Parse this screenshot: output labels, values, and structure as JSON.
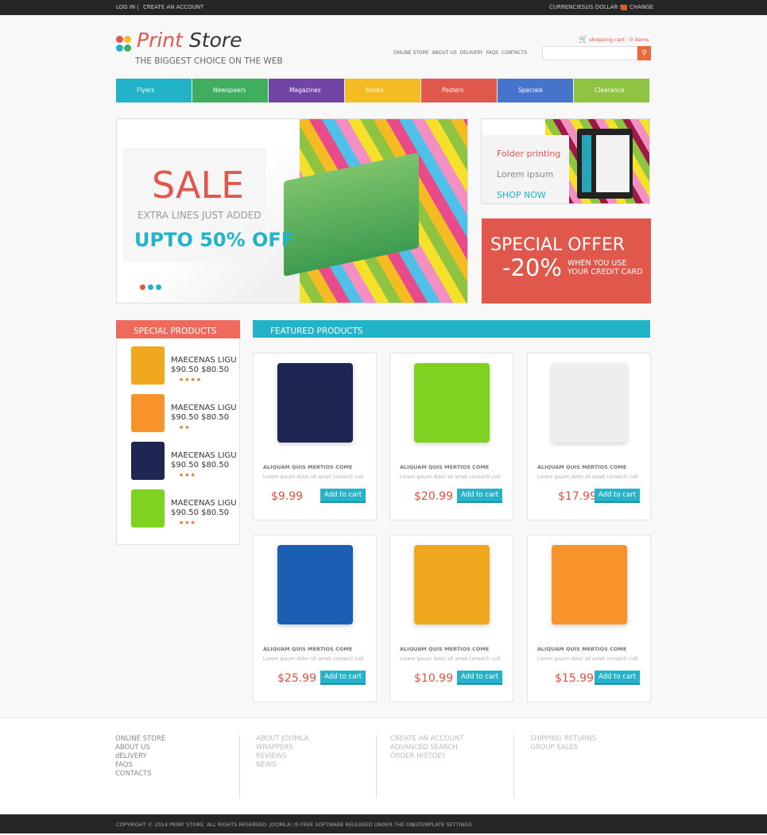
{
  "topbar": {
    "login": "LOG IN",
    "sep": "|",
    "create_account": "CREATE AN ACCOUNT",
    "currencies_label": "CURRENCIES:",
    "currency": "US DOLLAR $",
    "change": "CHANGE"
  },
  "header": {
    "logo_word1": "Print",
    "logo_word2": "Store",
    "tagline": "THE BIGGEST CHOICE ON THE WEB",
    "nav": [
      "ONLINE STORE",
      "ABOUT US",
      "DELIVERY",
      "FAQS",
      "CONTACTS"
    ],
    "cart": "shopping cart : 0 items",
    "search_placeholder": ""
  },
  "menu": [
    {
      "label": "Flyers",
      "color": "#22b3c9"
    },
    {
      "label": "Newspaers",
      "color": "#3fae5e"
    },
    {
      "label": "Magazines",
      "color": "#7045a6"
    },
    {
      "label": "Books",
      "color": "#f5bb23"
    },
    {
      "label": "Posters",
      "color": "#e0574b"
    },
    {
      "label": "Specials",
      "color": "#4674cb"
    },
    {
      "label": "Clearance",
      "color": "#8fc443"
    }
  ],
  "slider": {
    "title": "SALE",
    "line2": "EXTRA LINES JUST ADDED",
    "line3": "UPTO 50% OFF"
  },
  "banner_folder": {
    "title": "Folder printing",
    "subtitle": "Lorem ipsum",
    "cta": "SHOP NOW"
  },
  "banner_offer": {
    "title": "SPECIAL OFFER",
    "discount": "-20%",
    "line1": "WHEN YOU USE",
    "line2": "YOUR CREDIT CARD"
  },
  "special": {
    "title": "SPECIAL PRODUCTS",
    "items": [
      {
        "name": "MAECENAS LIGU",
        "price": "$90.50 $80.50",
        "stars": "★★★★",
        "color": "#f0a81f"
      },
      {
        "name": "MAECENAS LIGU",
        "price": "$90.50 $80.50",
        "stars": "★★",
        "color": "#f6932a"
      },
      {
        "name": "MAECENAS LIGU",
        "price": "$90.50 $80.50",
        "stars": "★★★",
        "color": "#1d2752"
      },
      {
        "name": "MAECENAS LIGU",
        "price": "$90.50 $80.50",
        "stars": "★★★",
        "color": "#7ed321"
      }
    ]
  },
  "featured": {
    "title": "FEATURED PRODUCTS",
    "add_label": "Add to cart",
    "products": [
      {
        "name": "ALIQUAM QUIS MERTIOS COME",
        "desc": "Lorem ipsum dolor sit amet consectr coll",
        "price": "$9.99",
        "color": "#1d2752"
      },
      {
        "name": "ALIQUAM QUIS MERTIOS COME",
        "desc": "Lorem ipsum dolor sit amet consectr coll",
        "price": "$20.99",
        "color": "#7ed321"
      },
      {
        "name": "ALIQUAM QUIS MERTIOS COME",
        "desc": "Lorem ipsum dolor sit amet consectr coll",
        "price": "$17.99",
        "color": "#eeeeee"
      },
      {
        "name": "ALIQUAM QUIS MERTIOS COME",
        "desc": "Lorem ipsum dolor sit amet consectr coll",
        "price": "$25.99",
        "color": "#1a5fb4"
      },
      {
        "name": "ALIQUAM QUIS MERTIOS COME",
        "desc": "Lorem ipsum dolor sit amet consectr coll",
        "price": "$10.99",
        "color": "#f0a81f"
      },
      {
        "name": "ALIQUAM QUIS MERTIOS COME",
        "desc": "Lorem ipsum dolor sit amet consectr coll",
        "price": "$15.99",
        "color": "#f6932a"
      }
    ]
  },
  "footer": {
    "cols": [
      [
        "ONLINE STORE",
        "ABOUT US",
        "dELIVERY",
        "FAQS",
        "CONTACTS"
      ],
      [
        "ABOUT JOOMLA",
        "WRAPPERS",
        "REVIEWS",
        "NEWS"
      ],
      [
        "CREATE AN ACCOUNT",
        "ADVANCED SEARCH",
        "ORDER HISTOEY"
      ],
      [
        "SHIPPING RETURNS",
        "GROUP SALES"
      ]
    ],
    "copyright": "COPYRIGHT © 2014 PRINT STORE. ALL RIGHTS RESERVED. JOOMLA! IS FREE SOFTWARE RELEASED UNDER THE GNU.",
    "sep": "|",
    "template_settings": "TEMPLATE SETTINGS"
  }
}
